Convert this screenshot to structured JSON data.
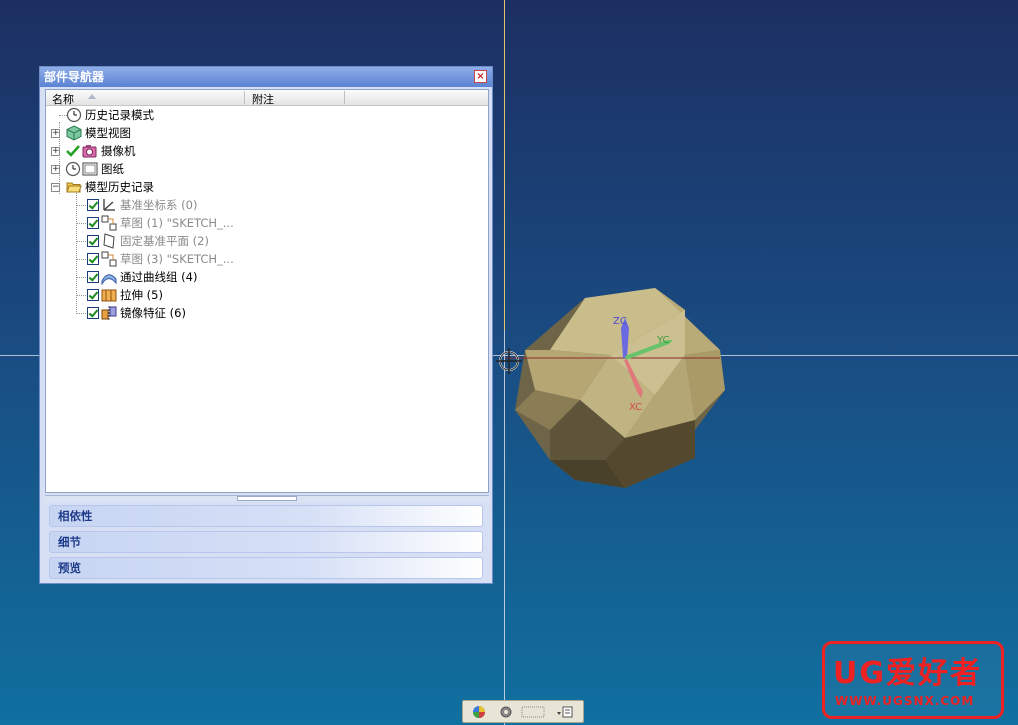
{
  "navigator": {
    "title": "部件导航器",
    "close_glyph": "×",
    "columns": {
      "name": "名称",
      "notes": "附注"
    },
    "tree": {
      "history_mode": "历史记录模式",
      "model_views": "模型视图",
      "cameras": "摄像机",
      "drawings": "图纸",
      "model_history": "模型历史记录",
      "features": [
        {
          "label": "基准坐标系 (0)",
          "dim": true
        },
        {
          "label": "草图 (1) \"SKETCH_...",
          "dim": true
        },
        {
          "label": "固定基准平面 (2)",
          "dim": true
        },
        {
          "label": "草图 (3) \"SKETCH_...",
          "dim": true
        },
        {
          "label": "通过曲线组 (4)",
          "dim": false
        },
        {
          "label": "拉伸 (5)",
          "dim": false
        },
        {
          "label": "镜像特征 (6)",
          "dim": false
        }
      ]
    },
    "sections": {
      "dependencies": "相依性",
      "details": "细节",
      "preview": "预览"
    }
  },
  "viewport": {
    "axes": {
      "z": "ZC",
      "y": "YC",
      "x": "XC"
    },
    "colors": {
      "model": "#b7a979",
      "axis_x": "#e07a7a",
      "axis_y": "#6ac36a",
      "axis_z": "#6a6ae0"
    }
  },
  "watermark": {
    "main": "UG爱好者",
    "url": "WWW.UGSNX.COM"
  },
  "icons": {
    "history": "clock-icon",
    "model_views": "cube-icon",
    "cameras": "camera-icon",
    "drawings": "drawing-sheet-icon",
    "model_history": "folder-open-icon"
  }
}
